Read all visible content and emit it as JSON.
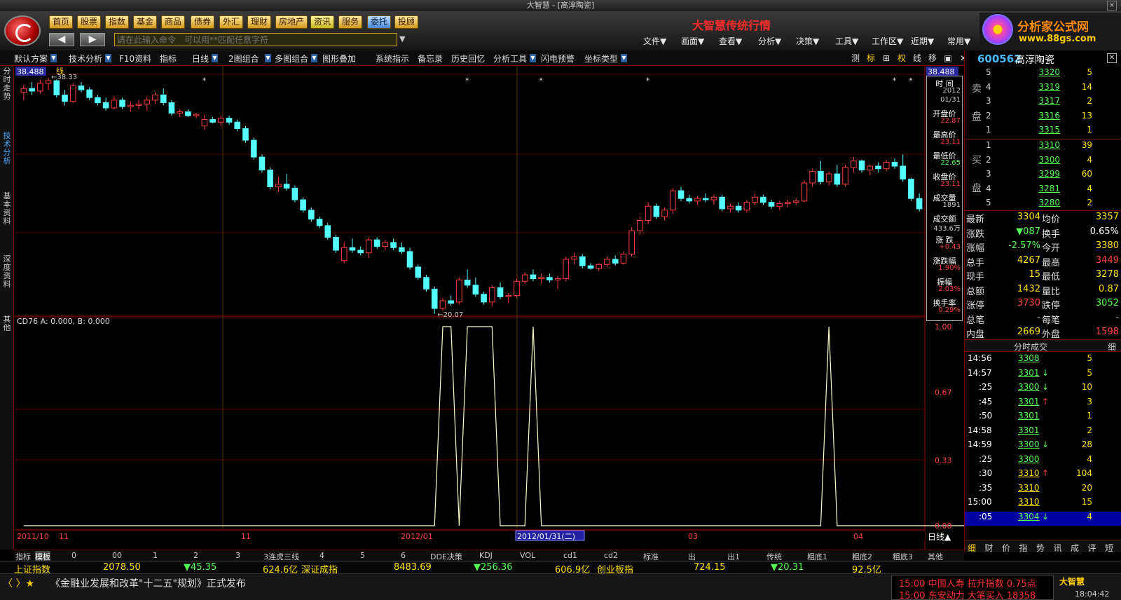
{
  "window": {
    "title": "大智慧 - [高淳陶瓷]",
    "close_icon": "×"
  },
  "topbar": {
    "nav": [
      "首页",
      "股票",
      "指数",
      "基金",
      "商品",
      "债券",
      "外汇",
      "理财",
      "房地产",
      "资讯",
      "服务",
      "委托",
      "投顾"
    ],
    "brand_title": "大智慧传统行情",
    "back": "◀",
    "forward": "▶",
    "command_placeholder": "请在此输入命令　可以用**匹配任意字符",
    "menus": [
      "文件▼",
      "画面▼",
      "查看▼",
      "分析▼",
      "决策▼",
      "工具▼",
      "工作区▼",
      "近期▼",
      "常用▼"
    ],
    "ad": {
      "line1": "分析家公式网",
      "line2": "www.88gs.com"
    }
  },
  "toolbar": {
    "items": [
      "默认方案",
      "技术分析",
      "F10资料",
      "指标",
      "日线",
      "2图组合",
      "多图组合",
      "图形叠加",
      "系统指示",
      "备忘录",
      "历史回忆",
      "分析工具",
      "闪电预警",
      "坐标类型"
    ],
    "right": [
      "测",
      "标",
      "⊞",
      "权",
      "线",
      "移",
      "▣",
      "✕"
    ]
  },
  "left_tabs": [
    "分时走势",
    "技术分析",
    "基本资料",
    "深度资料",
    "其他"
  ],
  "chart": {
    "price_high_label": "38.488",
    "high_marker": "38.33",
    "low_marker": "20.07",
    "indicator_label": "CD76  A: 0.000, B: 0.000",
    "indicator_scale": [
      "1.00",
      "0.67",
      "0.33",
      "0.00"
    ],
    "date_labels": [
      "2011/10",
      "11",
      "11",
      "2012/01",
      "2012/01/31(二)",
      "03",
      "04"
    ],
    "period": "日线",
    "line_label": "线"
  },
  "chart_data": {
    "type": "candlestick",
    "price_ylim": [
      20.07,
      38.488
    ],
    "candles": [
      [
        37.2,
        37.8,
        36.6,
        37.5
      ],
      [
        37.5,
        38.0,
        37.0,
        37.3
      ],
      [
        37.3,
        38.2,
        37.1,
        37.9
      ],
      [
        37.9,
        38.33,
        37.4,
        38.1
      ],
      [
        38.1,
        38.2,
        36.8,
        37.0
      ],
      [
        37.0,
        37.4,
        36.2,
        36.5
      ],
      [
        36.5,
        37.9,
        36.4,
        37.7
      ],
      [
        37.7,
        38.0,
        37.2,
        37.4
      ],
      [
        37.4,
        37.6,
        36.6,
        36.8
      ],
      [
        36.8,
        37.0,
        36.2,
        36.4
      ],
      [
        36.4,
        36.8,
        35.8,
        36.0
      ],
      [
        36.0,
        36.9,
        35.9,
        36.6
      ],
      [
        36.6,
        36.8,
        35.9,
        36.1
      ],
      [
        36.1,
        36.5,
        35.7,
        36.2
      ],
      [
        36.2,
        36.6,
        35.9,
        36.3
      ],
      [
        36.3,
        36.8,
        35.8,
        36.6
      ],
      [
        36.6,
        37.2,
        36.3,
        37.0
      ],
      [
        37.0,
        37.5,
        36.2,
        36.4
      ],
      [
        36.4,
        36.6,
        35.4,
        35.6
      ],
      [
        35.6,
        35.9,
        35.3,
        35.7
      ],
      [
        35.7,
        35.9,
        35.3,
        35.4
      ],
      [
        35.4,
        35.6,
        35.2,
        35.5
      ],
      [
        34.6,
        35.5,
        34.3,
        35.1
      ],
      [
        35.1,
        35.3,
        34.8,
        34.9
      ],
      [
        34.9,
        35.4,
        34.6,
        35.2
      ],
      [
        35.2,
        35.4,
        34.7,
        34.9
      ],
      [
        34.9,
        35.1,
        34.2,
        34.4
      ],
      [
        34.4,
        34.6,
        33.3,
        33.5
      ],
      [
        33.5,
        33.7,
        32.0,
        32.2
      ],
      [
        32.2,
        32.4,
        31.0,
        31.2
      ],
      [
        31.2,
        31.4,
        29.7,
        29.9
      ],
      [
        29.9,
        30.7,
        29.5,
        30.1
      ],
      [
        30.1,
        30.9,
        29.6,
        29.8
      ],
      [
        29.8,
        30.0,
        28.7,
        28.9
      ],
      [
        28.9,
        29.1,
        27.9,
        28.1
      ],
      [
        28.1,
        28.3,
        27.2,
        27.4
      ],
      [
        27.4,
        27.6,
        26.7,
        26.9
      ],
      [
        26.9,
        27.1,
        25.8,
        26.0
      ],
      [
        26.0,
        26.2,
        24.8,
        25.0
      ],
      [
        24.2,
        25.6,
        24.0,
        25.2
      ],
      [
        25.2,
        25.9,
        24.8,
        25.0
      ],
      [
        25.0,
        25.3,
        24.6,
        24.8
      ],
      [
        24.8,
        26.0,
        24.4,
        25.8
      ],
      [
        25.8,
        26.0,
        25.1,
        25.3
      ],
      [
        25.3,
        25.8,
        25.0,
        25.6
      ],
      [
        25.6,
        25.9,
        25.0,
        25.2
      ],
      [
        25.2,
        25.6,
        24.7,
        24.9
      ],
      [
        24.9,
        25.2,
        23.5,
        23.7
      ],
      [
        23.7,
        23.9,
        22.7,
        22.9
      ],
      [
        22.9,
        23.1,
        21.8,
        22.0
      ],
      [
        22.0,
        22.2,
        20.07,
        20.5
      ],
      [
        20.5,
        21.3,
        20.3,
        21.1
      ],
      [
        21.1,
        21.5,
        20.7,
        20.9
      ],
      [
        21.0,
        22.9,
        20.8,
        22.7
      ],
      [
        22.7,
        23.5,
        22.1,
        22.3
      ],
      [
        22.3,
        22.9,
        21.4,
        21.6
      ],
      [
        21.6,
        21.8,
        20.8,
        21.0
      ],
      [
        21.0,
        22.3,
        20.7,
        22.1
      ],
      [
        22.1,
        22.5,
        21.2,
        21.4
      ],
      [
        21.4,
        21.7,
        20.9,
        21.5
      ],
      [
        21.5,
        22.8,
        21.3,
        22.6
      ],
      [
        22.6,
        23.3,
        22.4,
        23.1
      ],
      [
        23.1,
        23.5,
        22.6,
        22.8
      ],
      [
        22.8,
        23.2,
        22.4,
        22.9
      ],
      [
        22.9,
        23.2,
        22.5,
        22.7
      ],
      [
        22.7,
        23.0,
        22.0,
        22.8
      ],
      [
        22.8,
        24.5,
        22.6,
        24.3
      ],
      [
        24.3,
        24.8,
        23.9,
        24.5
      ],
      [
        24.5,
        24.7,
        23.6,
        23.8
      ],
      [
        23.8,
        24.0,
        23.5,
        23.6
      ],
      [
        23.6,
        24.0,
        23.4,
        23.9
      ],
      [
        23.9,
        24.5,
        23.7,
        24.3
      ],
      [
        24.3,
        24.6,
        23.8,
        24.0
      ],
      [
        24.0,
        24.9,
        23.9,
        24.7
      ],
      [
        24.7,
        26.8,
        24.5,
        26.5
      ],
      [
        26.5,
        27.6,
        26.2,
        27.3
      ],
      [
        27.3,
        28.7,
        27.0,
        28.4
      ],
      [
        28.4,
        28.6,
        27.4,
        27.6
      ],
      [
        27.6,
        28.3,
        27.3,
        28.1
      ],
      [
        28.1,
        29.8,
        27.8,
        29.6
      ],
      [
        29.6,
        29.9,
        28.8,
        29.0
      ],
      [
        29.0,
        29.3,
        28.6,
        28.8
      ],
      [
        28.8,
        29.2,
        28.5,
        29.0
      ],
      [
        29.0,
        29.4,
        28.7,
        28.9
      ],
      [
        28.9,
        29.3,
        28.5,
        29.1
      ],
      [
        29.1,
        29.3,
        28.0,
        28.2
      ],
      [
        28.2,
        28.6,
        27.9,
        28.4
      ],
      [
        28.4,
        28.7,
        27.9,
        28.1
      ],
      [
        28.1,
        28.9,
        27.9,
        28.7
      ],
      [
        28.7,
        29.4,
        28.5,
        29.1
      ],
      [
        29.1,
        29.3,
        28.5,
        28.7
      ],
      [
        28.7,
        28.9,
        28.2,
        28.4
      ],
      [
        28.4,
        28.8,
        28.1,
        28.6
      ],
      [
        28.6,
        28.9,
        28.3,
        28.7
      ],
      [
        28.7,
        29.0,
        28.5,
        28.8
      ],
      [
        28.8,
        30.4,
        28.7,
        30.2
      ],
      [
        30.2,
        31.3,
        29.9,
        31.1
      ],
      [
        31.1,
        31.9,
        30.1,
        30.3
      ],
      [
        30.3,
        31.1,
        30.0,
        30.9
      ],
      [
        30.9,
        31.6,
        29.9,
        30.1
      ],
      [
        30.1,
        31.6,
        29.9,
        31.4
      ],
      [
        31.4,
        32.2,
        31.0,
        31.9
      ],
      [
        31.9,
        32.0,
        31.0,
        31.2
      ],
      [
        31.2,
        31.6,
        30.8,
        31.5
      ],
      [
        31.5,
        31.8,
        31.0,
        31.3
      ],
      [
        31.3,
        32.0,
        31.1,
        31.8
      ],
      [
        31.8,
        32.1,
        31.3,
        31.5
      ],
      [
        31.5,
        32.4,
        30.3,
        30.5
      ],
      [
        30.5,
        30.6,
        28.8,
        29.0
      ],
      [
        29.0,
        29.4,
        28.0,
        28.2
      ]
    ],
    "indicator": {
      "name": "CD76",
      "ylim": [
        0,
        1
      ],
      "values": [
        0,
        0,
        0,
        0,
        0,
        0,
        0,
        0,
        0,
        0,
        0,
        0,
        0,
        0,
        0,
        0,
        0,
        0,
        0,
        0,
        0,
        0,
        0,
        0,
        0,
        0,
        0,
        0,
        0,
        0,
        0,
        0,
        0,
        0,
        0,
        0,
        0,
        0,
        0,
        0,
        0,
        0,
        0,
        0,
        0,
        0,
        0,
        0,
        0,
        0,
        0,
        1,
        1,
        0,
        1,
        1,
        1,
        1,
        0,
        0,
        0,
        0,
        1,
        0,
        0,
        0,
        0,
        0,
        0,
        0,
        0,
        0,
        0,
        0,
        0,
        0,
        0,
        0,
        0,
        0,
        0,
        0,
        0,
        0,
        0,
        0,
        0,
        0,
        0,
        0,
        0,
        0,
        0,
        0,
        0,
        0,
        0,
        0,
        1,
        0,
        0,
        0,
        0,
        0,
        0,
        0,
        0,
        0,
        0,
        0,
        0,
        0,
        0,
        0,
        0,
        0,
        0,
        0,
        0,
        0
      ]
    }
  },
  "infobox": [
    {
      "label": "时 间",
      "value": "2012"
    },
    {
      "label": "",
      "value": "01/31"
    },
    {
      "label": "开盘价",
      "value": "22.87"
    },
    {
      "label": "最高价",
      "value": "23.11"
    },
    {
      "label": "最低价",
      "value": "22.65"
    },
    {
      "label": "收盘价",
      "value": "23.11"
    },
    {
      "label": "成交量",
      "value": "1891"
    },
    {
      "label": "成交额",
      "value": "433.6万"
    },
    {
      "label": "涨 跌",
      "value": "+0.43"
    },
    {
      "label": "涨跌幅",
      "value": "1.90%"
    },
    {
      "label": "振幅",
      "value": "2.03%"
    },
    {
      "label": "换手率",
      "value": "0.29%"
    }
  ],
  "quote": {
    "code": "600562",
    "name": "高淳陶瓷",
    "close": "✕",
    "sell_label": [
      "卖",
      "盘"
    ],
    "buy_label": [
      "买",
      "盘"
    ],
    "sell": [
      {
        "lvl": "5",
        "price": "3320",
        "qty": "5"
      },
      {
        "lvl": "4",
        "price": "3319",
        "qty": "14"
      },
      {
        "lvl": "3",
        "price": "3317",
        "qty": "2"
      },
      {
        "lvl": "2",
        "price": "3316",
        "qty": "13"
      },
      {
        "lvl": "1",
        "price": "3315",
        "qty": "1"
      }
    ],
    "buy": [
      {
        "lvl": "1",
        "price": "3310",
        "qty": "39"
      },
      {
        "lvl": "2",
        "price": "3300",
        "qty": "4"
      },
      {
        "lvl": "3",
        "price": "3299",
        "qty": "60"
      },
      {
        "lvl": "4",
        "price": "3281",
        "qty": "4"
      },
      {
        "lvl": "5",
        "price": "3280",
        "qty": "2"
      }
    ],
    "stats": [
      [
        "最新",
        "3304",
        "均价",
        "3357"
      ],
      [
        "涨跌",
        "▼087",
        "换手",
        "0.65%"
      ],
      [
        "涨幅",
        "-2.57%",
        "今开",
        "3380"
      ],
      [
        "总手",
        "4267",
        "最高",
        "3449"
      ],
      [
        "现手",
        "15",
        "最低",
        "3278"
      ],
      [
        "总额",
        "1432",
        "量比",
        "0.87"
      ],
      [
        "涨停",
        "3730",
        "跌停",
        "3052"
      ],
      [
        "总笔",
        "-",
        "每笔",
        "-"
      ],
      [
        "内盘",
        "2669",
        "外盘",
        "1598"
      ]
    ],
    "ticks_title": "分时成交",
    "ticks_tab": "细",
    "ticks": [
      [
        "14:56",
        "3308",
        "",
        "5"
      ],
      [
        "14:57",
        "3301",
        "↓",
        "5"
      ],
      [
        ":25",
        "3300",
        "↓",
        "10"
      ],
      [
        ":45",
        "3301",
        "↑",
        "3"
      ],
      [
        ":50",
        "3301",
        "",
        "1"
      ],
      [
        "14:58",
        "3301",
        "",
        "2"
      ],
      [
        "14:59",
        "3300",
        "↓",
        "28"
      ],
      [
        ":25",
        "3300",
        "",
        "4"
      ],
      [
        ":30",
        "3310",
        "↑",
        "104"
      ],
      [
        ":35",
        "3310",
        "",
        "20"
      ],
      [
        "15:00",
        "3310",
        "",
        "15"
      ],
      [
        ":05",
        "3304",
        "↓",
        "4"
      ]
    ],
    "tabs": [
      "细",
      "财",
      "价",
      "指",
      "势",
      "讯",
      "成",
      "评",
      "短"
    ]
  },
  "bottom_tabs": [
    "指标",
    "模板",
    "0",
    "00",
    "1",
    "2",
    "3",
    "3连虎三线",
    "4",
    "5",
    "6",
    "DDE决策",
    "KDJ",
    "VOL",
    "cd1",
    "cd2",
    "标准",
    "出",
    "出1",
    "传统",
    "粗底1",
    "粗底2",
    "粗底3",
    "其他"
  ],
  "status": {
    "i1_name": "上证指数",
    "i1_val": "2078.50",
    "i1_chg": "▼45.35",
    "i1_amt": "624.6亿",
    "i2_name": "深证成指",
    "i2_val": "8483.69",
    "i2_chg": "▼256.36",
    "i2_amt": "606.9亿",
    "i3_name": "创业板指",
    "i3_val": "724.15",
    "i3_chg": "▼20.31",
    "i3_amt": "92.5亿"
  },
  "news": {
    "controls": "〈 〉★",
    "headline": "《金融业发展和改革\"十二五\"规划》正式发布",
    "alert1": "15:00 中国人寿 拉升指数 0.75点",
    "alert2": "15:00 东安动力 大笔买入 18358",
    "brand": "大智慧",
    "clock": "18:04:42"
  },
  "colors": {
    "up": "#ff3c3c",
    "down": "#54ffff",
    "indicator": "#ffffcc",
    "grid": "#5a0000"
  }
}
